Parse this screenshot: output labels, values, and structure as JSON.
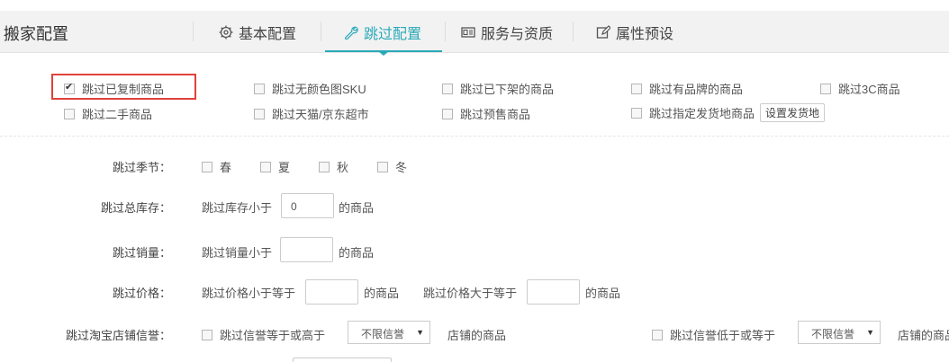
{
  "header": {
    "title": "搬家配置",
    "tabs": [
      {
        "label": "基本配置",
        "icon": "gear-icon"
      },
      {
        "label": "跳过配置",
        "icon": "wrench-icon",
        "active": true
      },
      {
        "label": "服务与资质",
        "icon": "id-card-icon"
      },
      {
        "label": "属性预设",
        "icon": "edit-icon"
      }
    ]
  },
  "options": {
    "skip_copied": {
      "label": "跳过已复制商品",
      "checked": true
    },
    "skip_no_color_sku": {
      "label": "跳过无颜色图SKU"
    },
    "skip_delisted": {
      "label": "跳过已下架的商品"
    },
    "skip_branded": {
      "label": "跳过有品牌的商品"
    },
    "skip_3c": {
      "label": "跳过3C商品"
    },
    "skip_secondhand": {
      "label": "跳过二手商品"
    },
    "skip_tmall_jd": {
      "label": "跳过天猫/京东超市"
    },
    "skip_presale": {
      "label": "跳过预售商品"
    },
    "skip_ship_from": {
      "label": "跳过指定发货地商品",
      "button": "设置发货地"
    }
  },
  "season": {
    "label": "跳过季节：",
    "items": [
      "春",
      "夏",
      "秋",
      "冬"
    ]
  },
  "stock": {
    "label": "跳过总库存：",
    "prefix": "跳过库存小于",
    "value": "0",
    "suffix": "的商品"
  },
  "sales": {
    "label": "跳过销量：",
    "prefix": "跳过销量小于",
    "value": "",
    "suffix": "的商品"
  },
  "price": {
    "label": "跳过价格：",
    "prefix_min": "跳过价格小于等于",
    "suffix_min": "的商品",
    "prefix_max": "跳过价格大于等于",
    "suffix_max": "的商品",
    "min_value": "",
    "max_value": ""
  },
  "credit": {
    "label": "跳过淘宝店铺信誉：",
    "gte_label": "跳过信誉等于或高于",
    "gte_select": "不限信誉",
    "gte_suffix": "店铺的商品",
    "lte_label": "跳过信誉低于或等于",
    "lte_select": "不限信誉",
    "lte_suffix": "店铺的商品"
  }
}
